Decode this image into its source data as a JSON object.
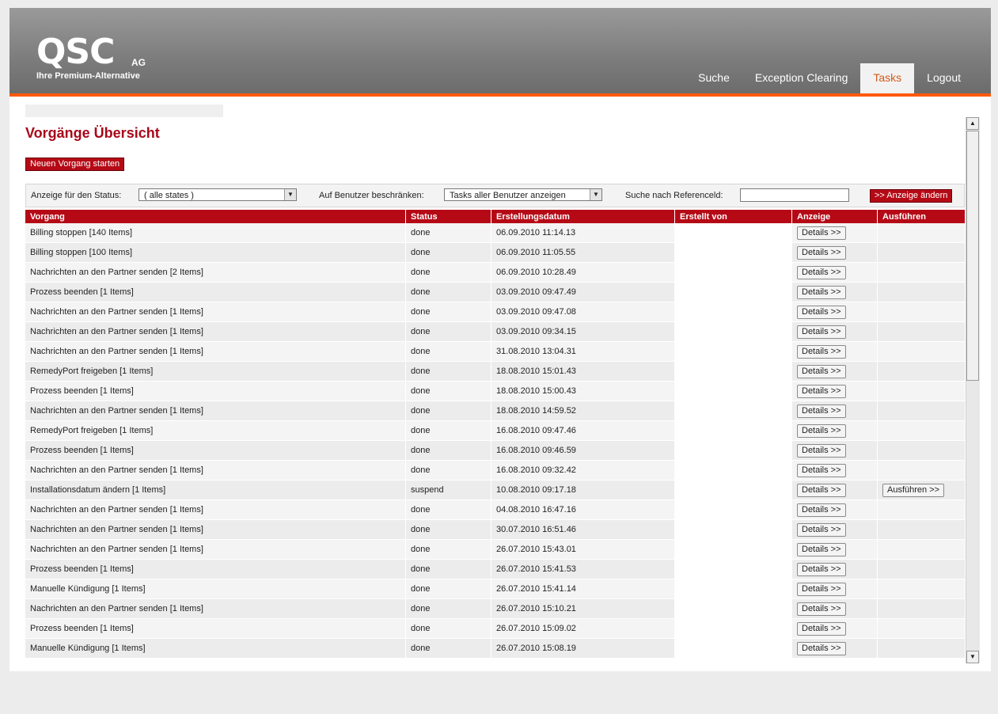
{
  "header": {
    "logo_name": "QSC",
    "logo_suffix": "AG",
    "logo_tagline": "Ihre Premium-Alternative",
    "nav": [
      {
        "label": "Suche",
        "active": false
      },
      {
        "label": "Exception Clearing",
        "active": false
      },
      {
        "label": "Tasks",
        "active": true
      },
      {
        "label": "Logout",
        "active": false
      }
    ],
    "accent_color": "#ff5a0a"
  },
  "page": {
    "title": "Vorgänge Übersicht",
    "start_button": "Neuen Vorgang starten",
    "title_color": "#a8071a"
  },
  "filters": {
    "status_label": "Anzeige für den Status:",
    "status_value": "( alle states )",
    "user_label": "Auf Benutzer beschränken:",
    "user_value": "Tasks aller Benutzer anzeigen",
    "ref_label": "Suche nach Referenceld:",
    "ref_value": "",
    "apply_button": ">> Anzeige ändern"
  },
  "table": {
    "columns": [
      "Vorgang",
      "Status",
      "Erstellungsdatum",
      "Erstellt von",
      "Anzeige",
      "Ausführen"
    ],
    "details_label": "Details >>",
    "execute_label": "Ausführen >>",
    "rows": [
      {
        "vorgang": "Billing stoppen [140 Items]",
        "status": "done",
        "datum": "06.09.2010 11:14.13",
        "execute": false
      },
      {
        "vorgang": "Billing stoppen [100 Items]",
        "status": "done",
        "datum": "06.09.2010 11:05.55",
        "execute": false
      },
      {
        "vorgang": "Nachrichten an den Partner senden [2 Items]",
        "status": "done",
        "datum": "06.09.2010 10:28.49",
        "execute": false
      },
      {
        "vorgang": "Prozess beenden [1 Items]",
        "status": "done",
        "datum": "03.09.2010 09:47.49",
        "execute": false
      },
      {
        "vorgang": "Nachrichten an den Partner senden [1 Items]",
        "status": "done",
        "datum": "03.09.2010 09:47.08",
        "execute": false
      },
      {
        "vorgang": "Nachrichten an den Partner senden [1 Items]",
        "status": "done",
        "datum": "03.09.2010 09:34.15",
        "execute": false
      },
      {
        "vorgang": "Nachrichten an den Partner senden [1 Items]",
        "status": "done",
        "datum": "31.08.2010 13:04.31",
        "execute": false
      },
      {
        "vorgang": "RemedyPort freigeben [1 Items]",
        "status": "done",
        "datum": "18.08.2010 15:01.43",
        "execute": false
      },
      {
        "vorgang": "Prozess beenden [1 Items]",
        "status": "done",
        "datum": "18.08.2010 15:00.43",
        "execute": false
      },
      {
        "vorgang": "Nachrichten an den Partner senden [1 Items]",
        "status": "done",
        "datum": "18.08.2010 14:59.52",
        "execute": false
      },
      {
        "vorgang": "RemedyPort freigeben [1 Items]",
        "status": "done",
        "datum": "16.08.2010 09:47.46",
        "execute": false
      },
      {
        "vorgang": "Prozess beenden [1 Items]",
        "status": "done",
        "datum": "16.08.2010 09:46.59",
        "execute": false
      },
      {
        "vorgang": "Nachrichten an den Partner senden [1 Items]",
        "status": "done",
        "datum": "16.08.2010 09:32.42",
        "execute": false
      },
      {
        "vorgang": "Installationsdatum ändern [1 Items]",
        "status": "suspend",
        "datum": "10.08.2010 09:17.18",
        "execute": true
      },
      {
        "vorgang": "Nachrichten an den Partner senden [1 Items]",
        "status": "done",
        "datum": "04.08.2010 16:47.16",
        "execute": false
      },
      {
        "vorgang": "Nachrichten an den Partner senden [1 Items]",
        "status": "done",
        "datum": "30.07.2010 16:51.46",
        "execute": false
      },
      {
        "vorgang": "Nachrichten an den Partner senden [1 Items]",
        "status": "done",
        "datum": "26.07.2010 15:43.01",
        "execute": false
      },
      {
        "vorgang": "Prozess beenden [1 Items]",
        "status": "done",
        "datum": "26.07.2010 15:41.53",
        "execute": false
      },
      {
        "vorgang": "Manuelle Kündigung [1 Items]",
        "status": "done",
        "datum": "26.07.2010 15:41.14",
        "execute": false
      },
      {
        "vorgang": "Nachrichten an den Partner senden [1 Items]",
        "status": "done",
        "datum": "26.07.2010 15:10.21",
        "execute": false
      },
      {
        "vorgang": "Prozess beenden [1 Items]",
        "status": "done",
        "datum": "26.07.2010 15:09.02",
        "execute": false
      },
      {
        "vorgang": "Manuelle Kündigung [1 Items]",
        "status": "done",
        "datum": "26.07.2010 15:08.19",
        "execute": false
      }
    ]
  }
}
